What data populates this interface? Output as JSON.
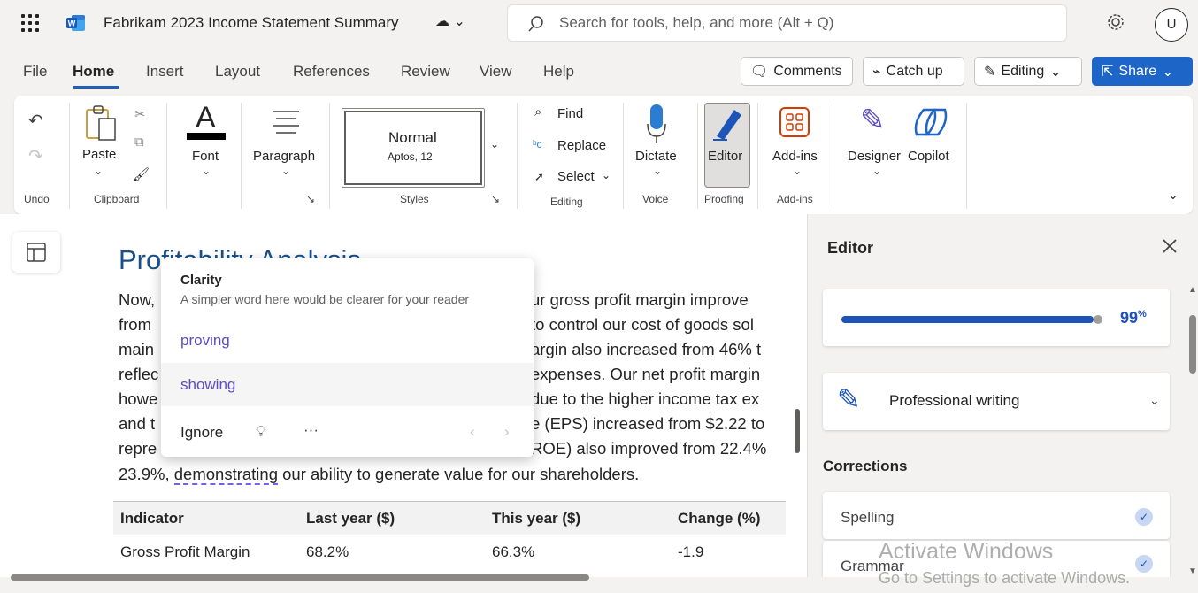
{
  "titlebar": {
    "doc_title": "Fabrikam 2023 Income Statement Summary",
    "search_placeholder": "Search for tools, help, and more (Alt + Q)",
    "avatar_initial": "U"
  },
  "menu": {
    "tabs": [
      "File",
      "Home",
      "Insert",
      "Layout",
      "References",
      "Review",
      "View",
      "Help"
    ],
    "active_tab": "Home",
    "comments_label": "Comments",
    "catchup_label": "Catch up",
    "editing_label": "Editing",
    "share_label": "Share"
  },
  "ribbon": {
    "undo_group": "Undo",
    "clipboard_group": "Clipboard",
    "paste_label": "Paste",
    "font_label": "Font",
    "paragraph_label": "Paragraph",
    "style_name": "Normal",
    "style_font": "Aptos, 12",
    "styles_group": "Styles",
    "find_label": "Find",
    "replace_label": "Replace",
    "select_label": "Select",
    "editing_group": "Editing",
    "dictate_label": "Dictate",
    "voice_group": "Voice",
    "editor_label": "Editor",
    "proofing_group": "Proofing",
    "addins_label": "Add-ins",
    "addins_group": "Add-ins",
    "designer_label": "Designer",
    "copilot_label": "Copilot"
  },
  "document": {
    "heading": "Profitability Analysis",
    "lines": [
      {
        "a": "Now,",
        "b": "ur gross profit margin improve"
      },
      {
        "a": "from",
        "b": "to control our cost of goods sol"
      },
      {
        "a": "main",
        "b": "argin also increased from 46% t"
      },
      {
        "a": "reflec",
        "b": "expenses. Our net profit margin"
      },
      {
        "a": "howe",
        "b": "due to the higher income tax ex"
      },
      {
        "a": "and t",
        "b": "e (EPS) increased from $2.22 to"
      },
      {
        "a": "repre",
        "b": "ROE) also improved from 22.4%"
      }
    ],
    "last_line_start": "23.9%, ",
    "flagged_word": "demonstrating",
    "last_line_end": " our ability to generate value for our shareholders.",
    "table": {
      "headers": [
        "Indicator",
        "Last year ($)",
        "This year ($)",
        "Change (%)"
      ],
      "rows": [
        [
          "Gross Profit Margin",
          "68.2%",
          "66.3%",
          "-1.9"
        ]
      ]
    }
  },
  "popup": {
    "title": "Clarity",
    "description": "A simpler word here would be clearer for your reader",
    "suggestions": [
      "proving",
      "showing"
    ],
    "ignore_label": "Ignore"
  },
  "editor_pane": {
    "title": "Editor",
    "score": "99",
    "score_unit": "%",
    "score_fraction": 0.99,
    "writing_style": "Professional writing",
    "corrections_title": "Corrections",
    "corrections": [
      "Spelling",
      "Grammar"
    ]
  },
  "watermark": {
    "line1": "Activate Windows",
    "line2": "Go to Settings to activate Windows."
  }
}
